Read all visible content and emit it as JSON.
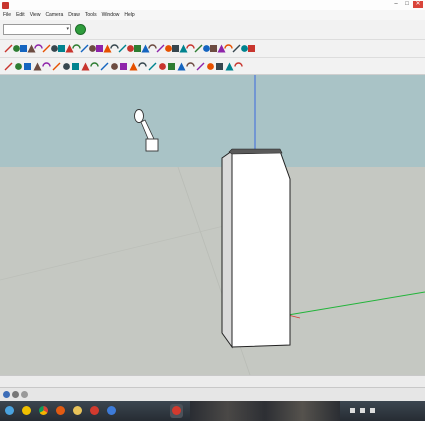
{
  "window": {
    "title": "",
    "controls": [
      "–",
      "□",
      "✕"
    ]
  },
  "menu": {
    "items": [
      "File",
      "Edit",
      "View",
      "Camera",
      "Draw",
      "Tools",
      "Window",
      "Help"
    ]
  },
  "style_dropdown": {
    "value": ""
  },
  "statusbar": {
    "measurements_label": "",
    "hint": ""
  },
  "colors": {
    "sky": "#a9c3c6",
    "ground": "#c5c8c2",
    "blue_axis": "#2f5fe0",
    "green_axis": "#22b43a",
    "red_axis": "#d43a2f"
  },
  "icons": {
    "titlebar": [
      "sketchup-app-icon"
    ],
    "toolbar_row1": [
      "add-location-icon"
    ],
    "toolbar_row2": [
      "line-icon",
      "freehand-icon",
      "rectangle-icon",
      "circle-icon",
      "arc-icon",
      "polygon-icon",
      "eraser-icon",
      "paint-bucket-icon",
      "push-pull-icon",
      "move-icon",
      "rotate-icon",
      "follow-me-icon",
      "scale-icon",
      "offset-icon",
      "tape-measure-icon",
      "dimension-icon",
      "protractor-icon",
      "text-icon",
      "axes-icon",
      "3d-text-icon",
      "orbit-icon",
      "pan-icon",
      "zoom-icon",
      "zoom-window-icon",
      "zoom-extents-icon",
      "previous-view-icon",
      "next-view-icon",
      "iso-view-icon",
      "top-view-icon",
      "front-view-icon",
      "right-view-icon",
      "back-view-icon",
      "left-view-icon"
    ],
    "toolbar_row3": [
      "select-icon",
      "make-component-icon",
      "paint-icon",
      "eraser-small-icon",
      "line-small-icon",
      "arc-small-icon",
      "shapes-icon",
      "push-pull-small-icon",
      "move-small-icon",
      "rotate-small-icon",
      "scale-small-icon",
      "offset-small-icon",
      "tape-small-icon",
      "text-small-icon",
      "axes-small-icon",
      "orbit-small-icon",
      "pan-small-icon",
      "zoom-small-icon",
      "zoom-extents-small-icon",
      "walk-icon",
      "look-around-icon",
      "position-camera-icon",
      "section-plane-icon",
      "warehouse-icon",
      "extension-icon"
    ],
    "status": [
      "geo-icon",
      "credits-icon",
      "user-icon"
    ],
    "taskbar": [
      "start-icon",
      "explorer-icon",
      "chrome-icon",
      "media-icon",
      "folder-icon",
      "sketchup-task-icon",
      "browser-task-icon"
    ]
  }
}
